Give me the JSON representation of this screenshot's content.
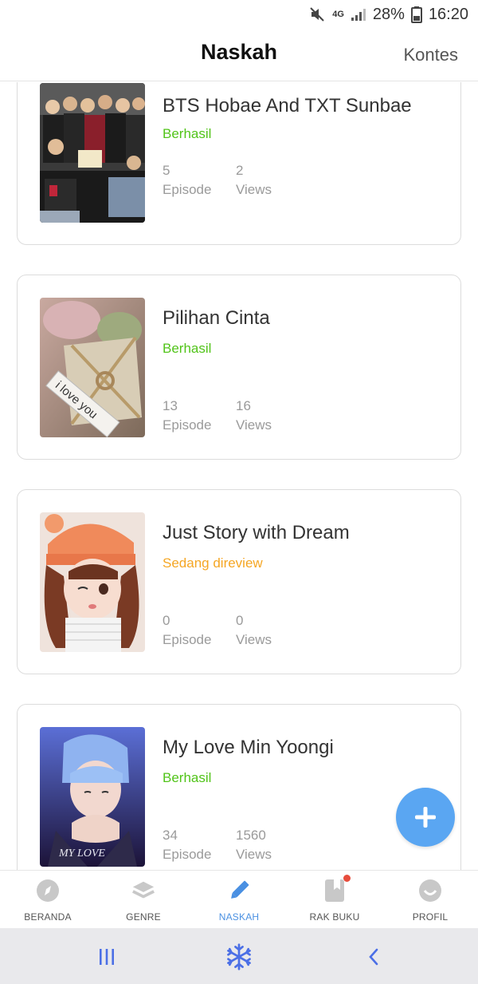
{
  "status_bar": {
    "network": "4G",
    "battery": "28%",
    "time": "16:20"
  },
  "header": {
    "title": "Naskah",
    "action": "Kontes"
  },
  "stories": [
    {
      "title": "BTS Hobae And TXT Sunbae",
      "status": "Berhasil",
      "status_color": "#52c41a",
      "episodes": "5",
      "episode_label": "Episode",
      "views": "2",
      "views_label": "Views"
    },
    {
      "title": "Pilihan Cinta",
      "status": "Berhasil",
      "status_color": "#52c41a",
      "episodes": "13",
      "episode_label": "Episode",
      "views": "16",
      "views_label": "Views",
      "cover_text": "i love you"
    },
    {
      "title": "Just Story with Dream",
      "status": "Sedang direview",
      "status_color": "#f5a623",
      "episodes": "0",
      "episode_label": "Episode",
      "views": "0",
      "views_label": "Views"
    },
    {
      "title": "My Love Min Yoongi",
      "status": "Berhasil",
      "status_color": "#52c41a",
      "episodes": "34",
      "episode_label": "Episode",
      "views": "1560",
      "views_label": "Views",
      "cover_text": "MY LOVE"
    }
  ],
  "bottom_nav": [
    {
      "label": "BERANDA",
      "icon": "compass-icon"
    },
    {
      "label": "GENRE",
      "icon": "layers-icon"
    },
    {
      "label": "NASKAH",
      "icon": "pencil-icon",
      "active": true
    },
    {
      "label": "RAK BUKU",
      "icon": "bookmark-book-icon",
      "badge": true
    },
    {
      "label": "PROFIL",
      "icon": "smile-icon"
    }
  ],
  "colors": {
    "accent": "#4a90e2",
    "fab": "#5aa6f2",
    "success": "#52c41a",
    "review": "#f5a623"
  }
}
